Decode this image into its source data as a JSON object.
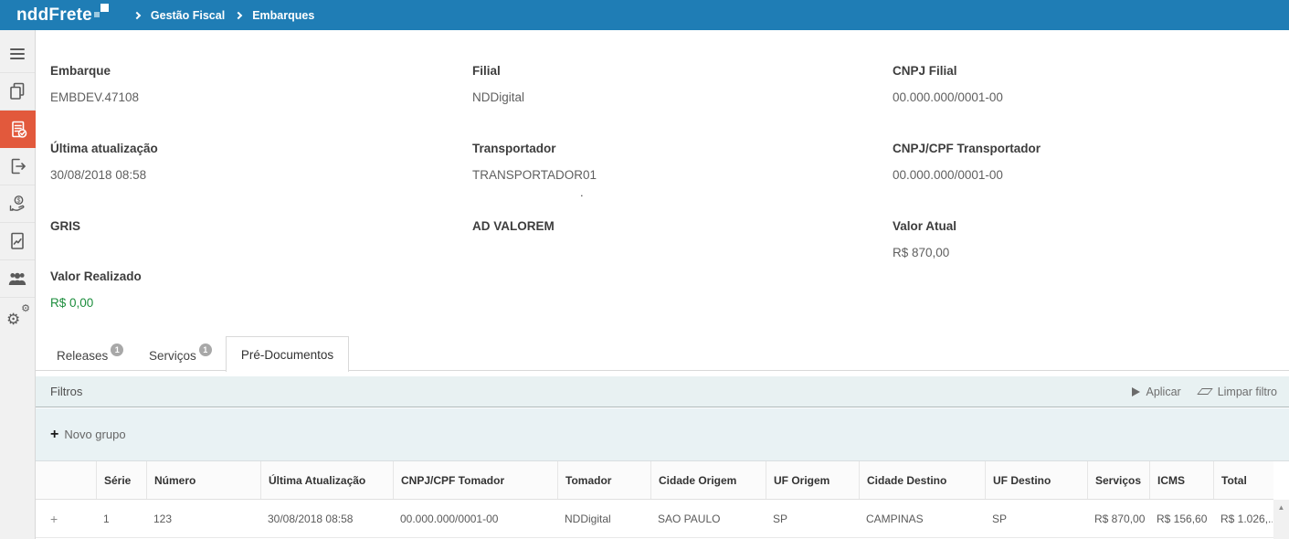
{
  "header": {
    "app_name": "nddFrete",
    "breadcrumb": {
      "level1": "Gestão Fiscal",
      "level2": "Embarques"
    }
  },
  "sidebar": {
    "items": [
      {
        "icon": "menu-icon"
      },
      {
        "icon": "copy-documents-icon"
      },
      {
        "icon": "document-check-icon",
        "active": true
      },
      {
        "icon": "export-icon"
      },
      {
        "icon": "money-hand-icon"
      },
      {
        "icon": "report-chart-icon"
      },
      {
        "icon": "users-icon"
      },
      {
        "icon": "settings-gears-icon"
      }
    ],
    "gear_glyph": "⚙"
  },
  "details": {
    "fields": [
      {
        "label": "Embarque",
        "value": "EMBDEV.47108"
      },
      {
        "label": "Filial",
        "value": "NDDigital"
      },
      {
        "label": "CNPJ Filial",
        "value": "00.000.000/0001-00"
      },
      {
        "label": "Última atualização",
        "value": "30/08/2018 08:58"
      },
      {
        "label": "Transportador",
        "value": "TRANSPORTADOR01"
      },
      {
        "label": "CNPJ/CPF Transportador",
        "value": "00.000.000/0001-00"
      },
      {
        "label": "GRIS",
        "value": ""
      },
      {
        "label": "AD VALOREM",
        "value": ""
      },
      {
        "label": "Valor Atual",
        "value": "R$ 870,00"
      },
      {
        "label": "Valor Realizado",
        "value": "R$ 0,00"
      }
    ],
    "stray_dot": "."
  },
  "tabs": [
    {
      "label": "Releases",
      "badge": "1"
    },
    {
      "label": "Serviços",
      "badge": "1"
    },
    {
      "label": "Pré-Documentos",
      "active": true
    }
  ],
  "filters": {
    "title": "Filtros",
    "apply_label": "Aplicar",
    "clear_label": "Limpar filtro"
  },
  "toolbar": {
    "plus_glyph": "+",
    "new_group_label": "Novo grupo"
  },
  "table": {
    "columns": [
      "",
      "Série",
      "Número",
      "Última Atualização",
      "CNPJ/CPF Tomador",
      "Tomador",
      "Cidade Origem",
      "UF Origem",
      "Cidade Destino",
      "UF Destino",
      "Serviços",
      "ICMS",
      "Total"
    ],
    "rows": [
      {
        "expand": "+",
        "serie": "1",
        "numero": "123",
        "ultima_atualizacao": "30/08/2018 08:58",
        "cnpj_cpf_tomador": "00.000.000/0001-00",
        "tomador": "NDDigital",
        "cidade_origem": "SAO PAULO",
        "uf_origem": "SP",
        "cidade_destino": "CAMPINAS",
        "uf_destino": "SP",
        "servicos": "R$ 870,00",
        "icms": "R$ 156,60",
        "total": "R$ 1.026,..."
      }
    ],
    "scroll_up_glyph": "▲"
  },
  "colors": {
    "header_bg": "#1F7DB5",
    "active_sidebar_item_bg": "#E2593C",
    "positive_value_green": "#1E8E3E",
    "filter_bar_bg": "#E8F1F2"
  }
}
